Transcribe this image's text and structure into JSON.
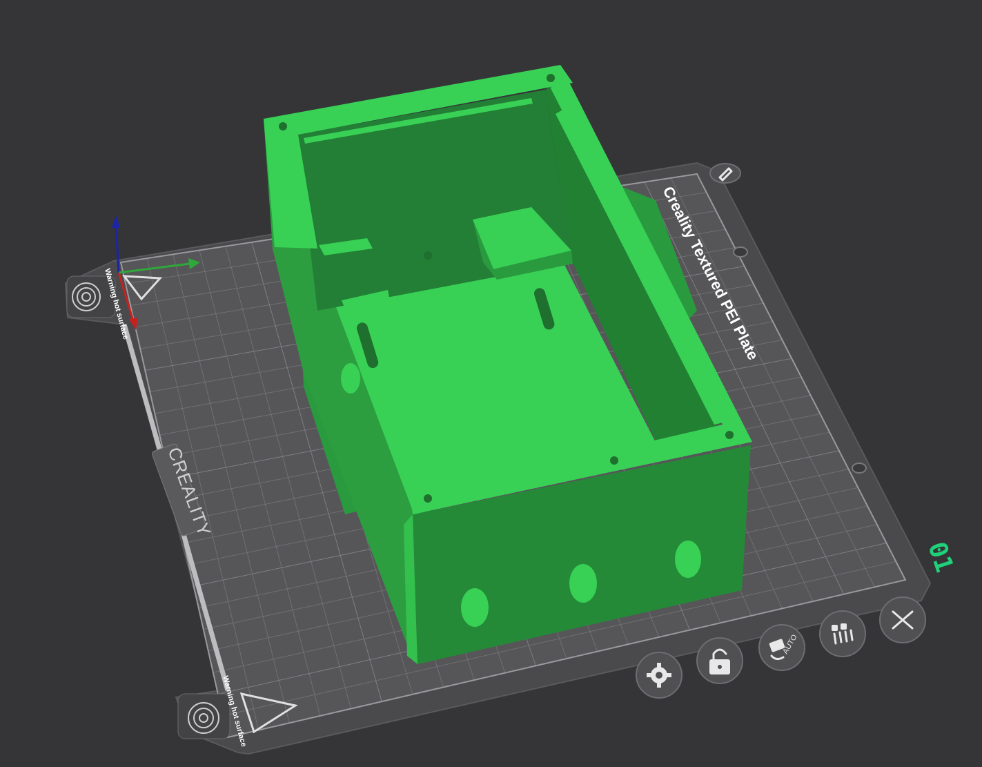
{
  "plate": {
    "name": "Creality Textured PEI Plate",
    "brand": "CREALITY",
    "warning_text": "Warning hot surface",
    "plate_number": "01",
    "colors": {
      "background": "#353538",
      "plate": "#4a4a4c",
      "grid": "#8a8a8e",
      "model_top": "#38d155",
      "model_side": "#258a38",
      "plate_number": "#1fd27a"
    }
  },
  "axes": {
    "x_color": "#c8201e",
    "y_color": "#2ea83a",
    "z_color": "#1c24a8"
  },
  "plate_toolbar": [
    {
      "id": "settings",
      "icon": "gear-icon"
    },
    {
      "id": "lock",
      "icon": "lock-icon"
    },
    {
      "id": "auto-orient",
      "icon": "auto-orient-icon",
      "label": "AUTO"
    },
    {
      "id": "arrange",
      "icon": "arrange-icon"
    },
    {
      "id": "delete",
      "icon": "close-icon"
    }
  ],
  "edit_name_icon": "pencil-icon"
}
